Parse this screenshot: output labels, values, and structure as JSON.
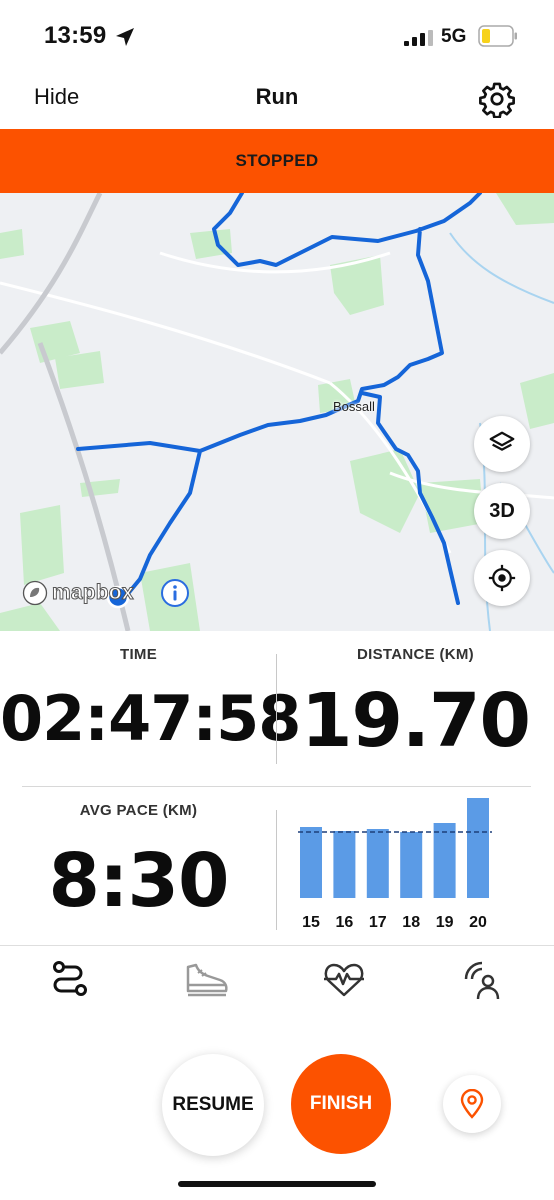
{
  "status_bar": {
    "time": "13:59",
    "network": "5G"
  },
  "header": {
    "hide_label": "Hide",
    "title": "Run"
  },
  "banner": {
    "text": "STOPPED",
    "color": "#fc5200"
  },
  "map": {
    "place_label": "Bossall",
    "three_d_label": "3D",
    "attribution_text": "mapbox",
    "route_color": "#1565d8"
  },
  "stats": {
    "time": {
      "label": "TIME",
      "value": "02:47:58"
    },
    "distance": {
      "label": "DISTANCE (KM)",
      "value": "19.70"
    },
    "avg_pace": {
      "label": "AVG PACE (KM)",
      "value": "8:30"
    }
  },
  "chart_data": {
    "type": "bar",
    "categories": [
      "15",
      "16",
      "17",
      "18",
      "19",
      "20"
    ],
    "values": [
      0.71,
      0.67,
      0.69,
      0.66,
      0.75,
      1.0
    ],
    "average": 0.66,
    "bar_color": "#5b9be6",
    "title": "",
    "xlabel": "",
    "ylabel": ""
  },
  "tabs": [
    {
      "icon": "route-icon"
    },
    {
      "icon": "shoe-icon"
    },
    {
      "icon": "heart-rate-icon"
    },
    {
      "icon": "beacon-icon"
    }
  ],
  "actions": {
    "resume_label": "RESUME",
    "finish_label": "FINISH",
    "pin_icon": "location-pin-icon",
    "accent": "#fc5200"
  }
}
